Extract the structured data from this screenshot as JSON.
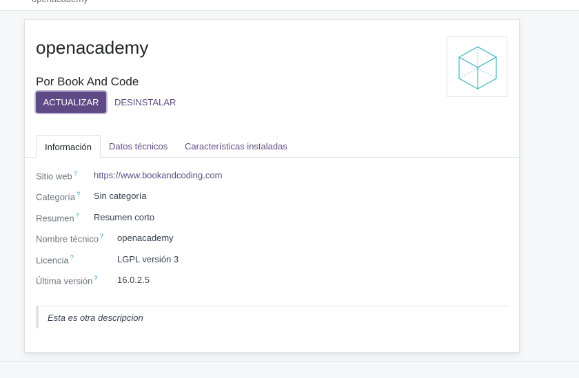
{
  "topbar": {
    "breadcrumb": "openacademy"
  },
  "module": {
    "title": "openacademy",
    "author": "Por Book And Code",
    "icon": "cube-icon"
  },
  "buttons": {
    "update": "ACTUALIZAR",
    "uninstall": "DESINSTALAR"
  },
  "tabs": [
    {
      "label": "Información",
      "active": true
    },
    {
      "label": "Datos técnicos",
      "active": false
    },
    {
      "label": "Características instaladas",
      "active": false
    }
  ],
  "fields": {
    "website": {
      "label": "Sitio web",
      "help": "?",
      "value": "https://www.bookandcoding.com"
    },
    "category": {
      "label": "Categoría",
      "help": "?",
      "value": "Sin categoría"
    },
    "summary": {
      "label": "Resumen",
      "help": "?",
      "value": "Resumen corto"
    },
    "technical_name": {
      "label": "Nombre técnico",
      "help": "?",
      "value": "openacademy"
    },
    "license": {
      "label": "Licencia",
      "help": "?",
      "value": "LGPL versión 3"
    },
    "latest_version": {
      "label": "Última versión",
      "help": "?",
      "value": "16.0.2.5"
    }
  },
  "description": "Esta es otra descripcion",
  "colors": {
    "primary": "#5e4b85",
    "help_marker": "#1f9bd1",
    "icon_stroke": "#4fb8c9"
  }
}
